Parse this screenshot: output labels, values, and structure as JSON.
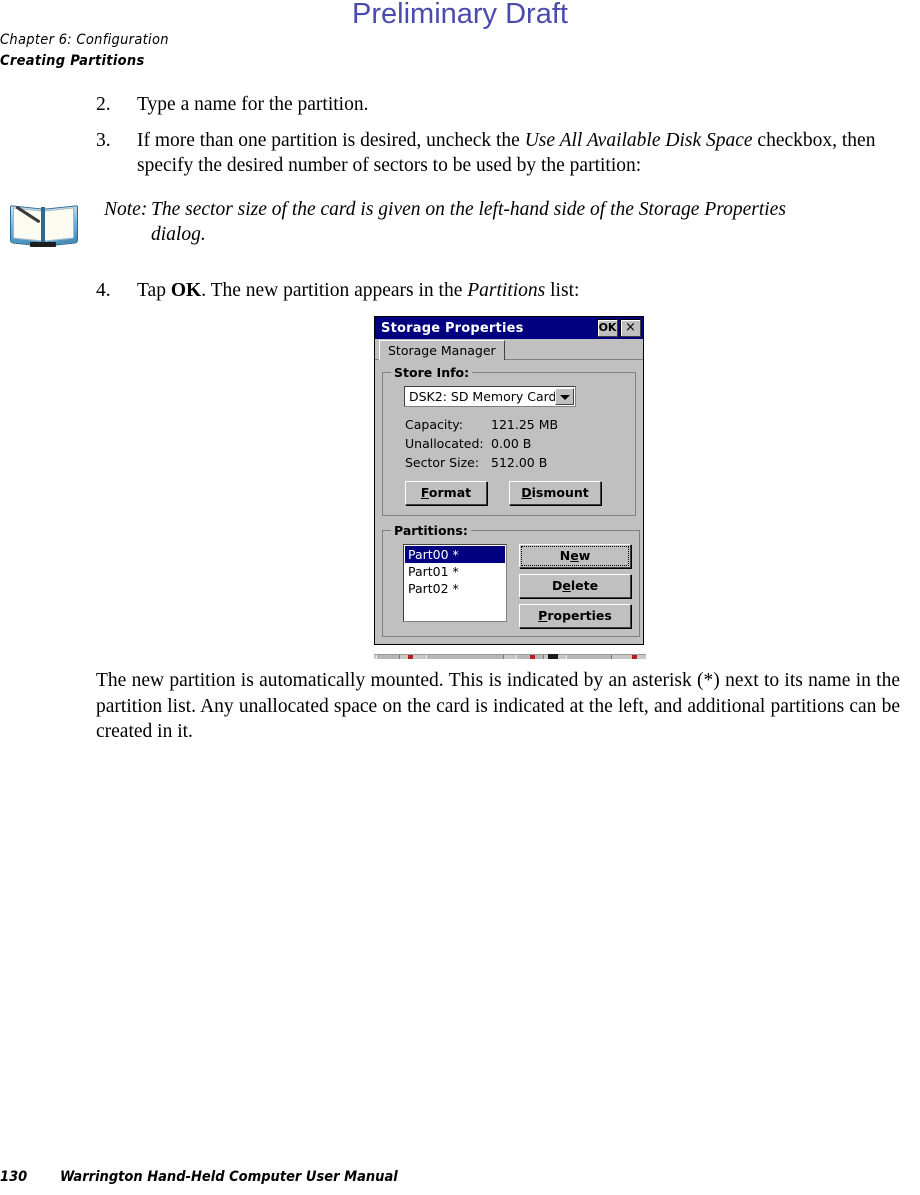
{
  "watermark": "Preliminary Draft",
  "header": {
    "chapter": "Chapter 6:  Configuration",
    "section": "Creating Partitions"
  },
  "steps": [
    {
      "num": "2.",
      "parts": [
        {
          "text": "Type a name for the partition.",
          "style": "normal"
        }
      ]
    },
    {
      "num": "3.",
      "parts": [
        {
          "text": "If more than one partition is desired, uncheck the ",
          "style": "normal"
        },
        {
          "text": "Use All Available Disk Space",
          "style": "italic"
        },
        {
          "text": " checkbox, then specify the desired number of sectors to be used by the partition:",
          "style": "normal"
        }
      ]
    }
  ],
  "note": {
    "icon": "open-book-icon",
    "label": "Note:",
    "text": "The sector size of the card is given on the left-hand side of the Storage Properties dialog."
  },
  "step4": {
    "num": "4.",
    "parts": [
      {
        "text": "Tap ",
        "style": "normal"
      },
      {
        "text": "OK",
        "style": "bold"
      },
      {
        "text": ". The new partition appears in the ",
        "style": "normal"
      },
      {
        "text": "Partitions",
        "style": "italic"
      },
      {
        "text": " list:",
        "style": "normal"
      }
    ]
  },
  "dialog": {
    "title": "Storage Properties",
    "ok_button": "OK",
    "close_button": "×",
    "tab": "Storage Manager",
    "store_info": {
      "legend": "Store Info:",
      "combo_value": "DSK2: SD Memory Card",
      "rows": [
        {
          "label": "Capacity:",
          "value": "121.25 MB"
        },
        {
          "label": "Unallocated:",
          "value": "0.00 B"
        },
        {
          "label": "Sector Size:",
          "value": "512.00 B"
        }
      ],
      "format_button": "Format",
      "format_accel": "F",
      "dismount_button": "Dismount",
      "dismount_accel": "D"
    },
    "partitions": {
      "legend": "Partitions:",
      "items": [
        {
          "name": "Part00 *",
          "selected": true
        },
        {
          "name": "Part01 *",
          "selected": false
        },
        {
          "name": "Part02 *",
          "selected": false
        }
      ],
      "new_button": "New",
      "new_accel": "N",
      "delete_button": "Delete",
      "delete_accel": "e",
      "properties_button": "Properties",
      "properties_accel": "P"
    },
    "colors": {
      "titlebar": "#000080",
      "face": "#c0c0c0",
      "selection": "#000080"
    }
  },
  "paragraph": "The new partition is automatically mounted. This is indicated by an asterisk (*) next to its name in the partition list. Any unallocated space on the card is indicated at the left, and additional partitions can be created in it.",
  "footer": {
    "page": "130",
    "manual": "Warrington Hand-Held Computer User Manual"
  }
}
